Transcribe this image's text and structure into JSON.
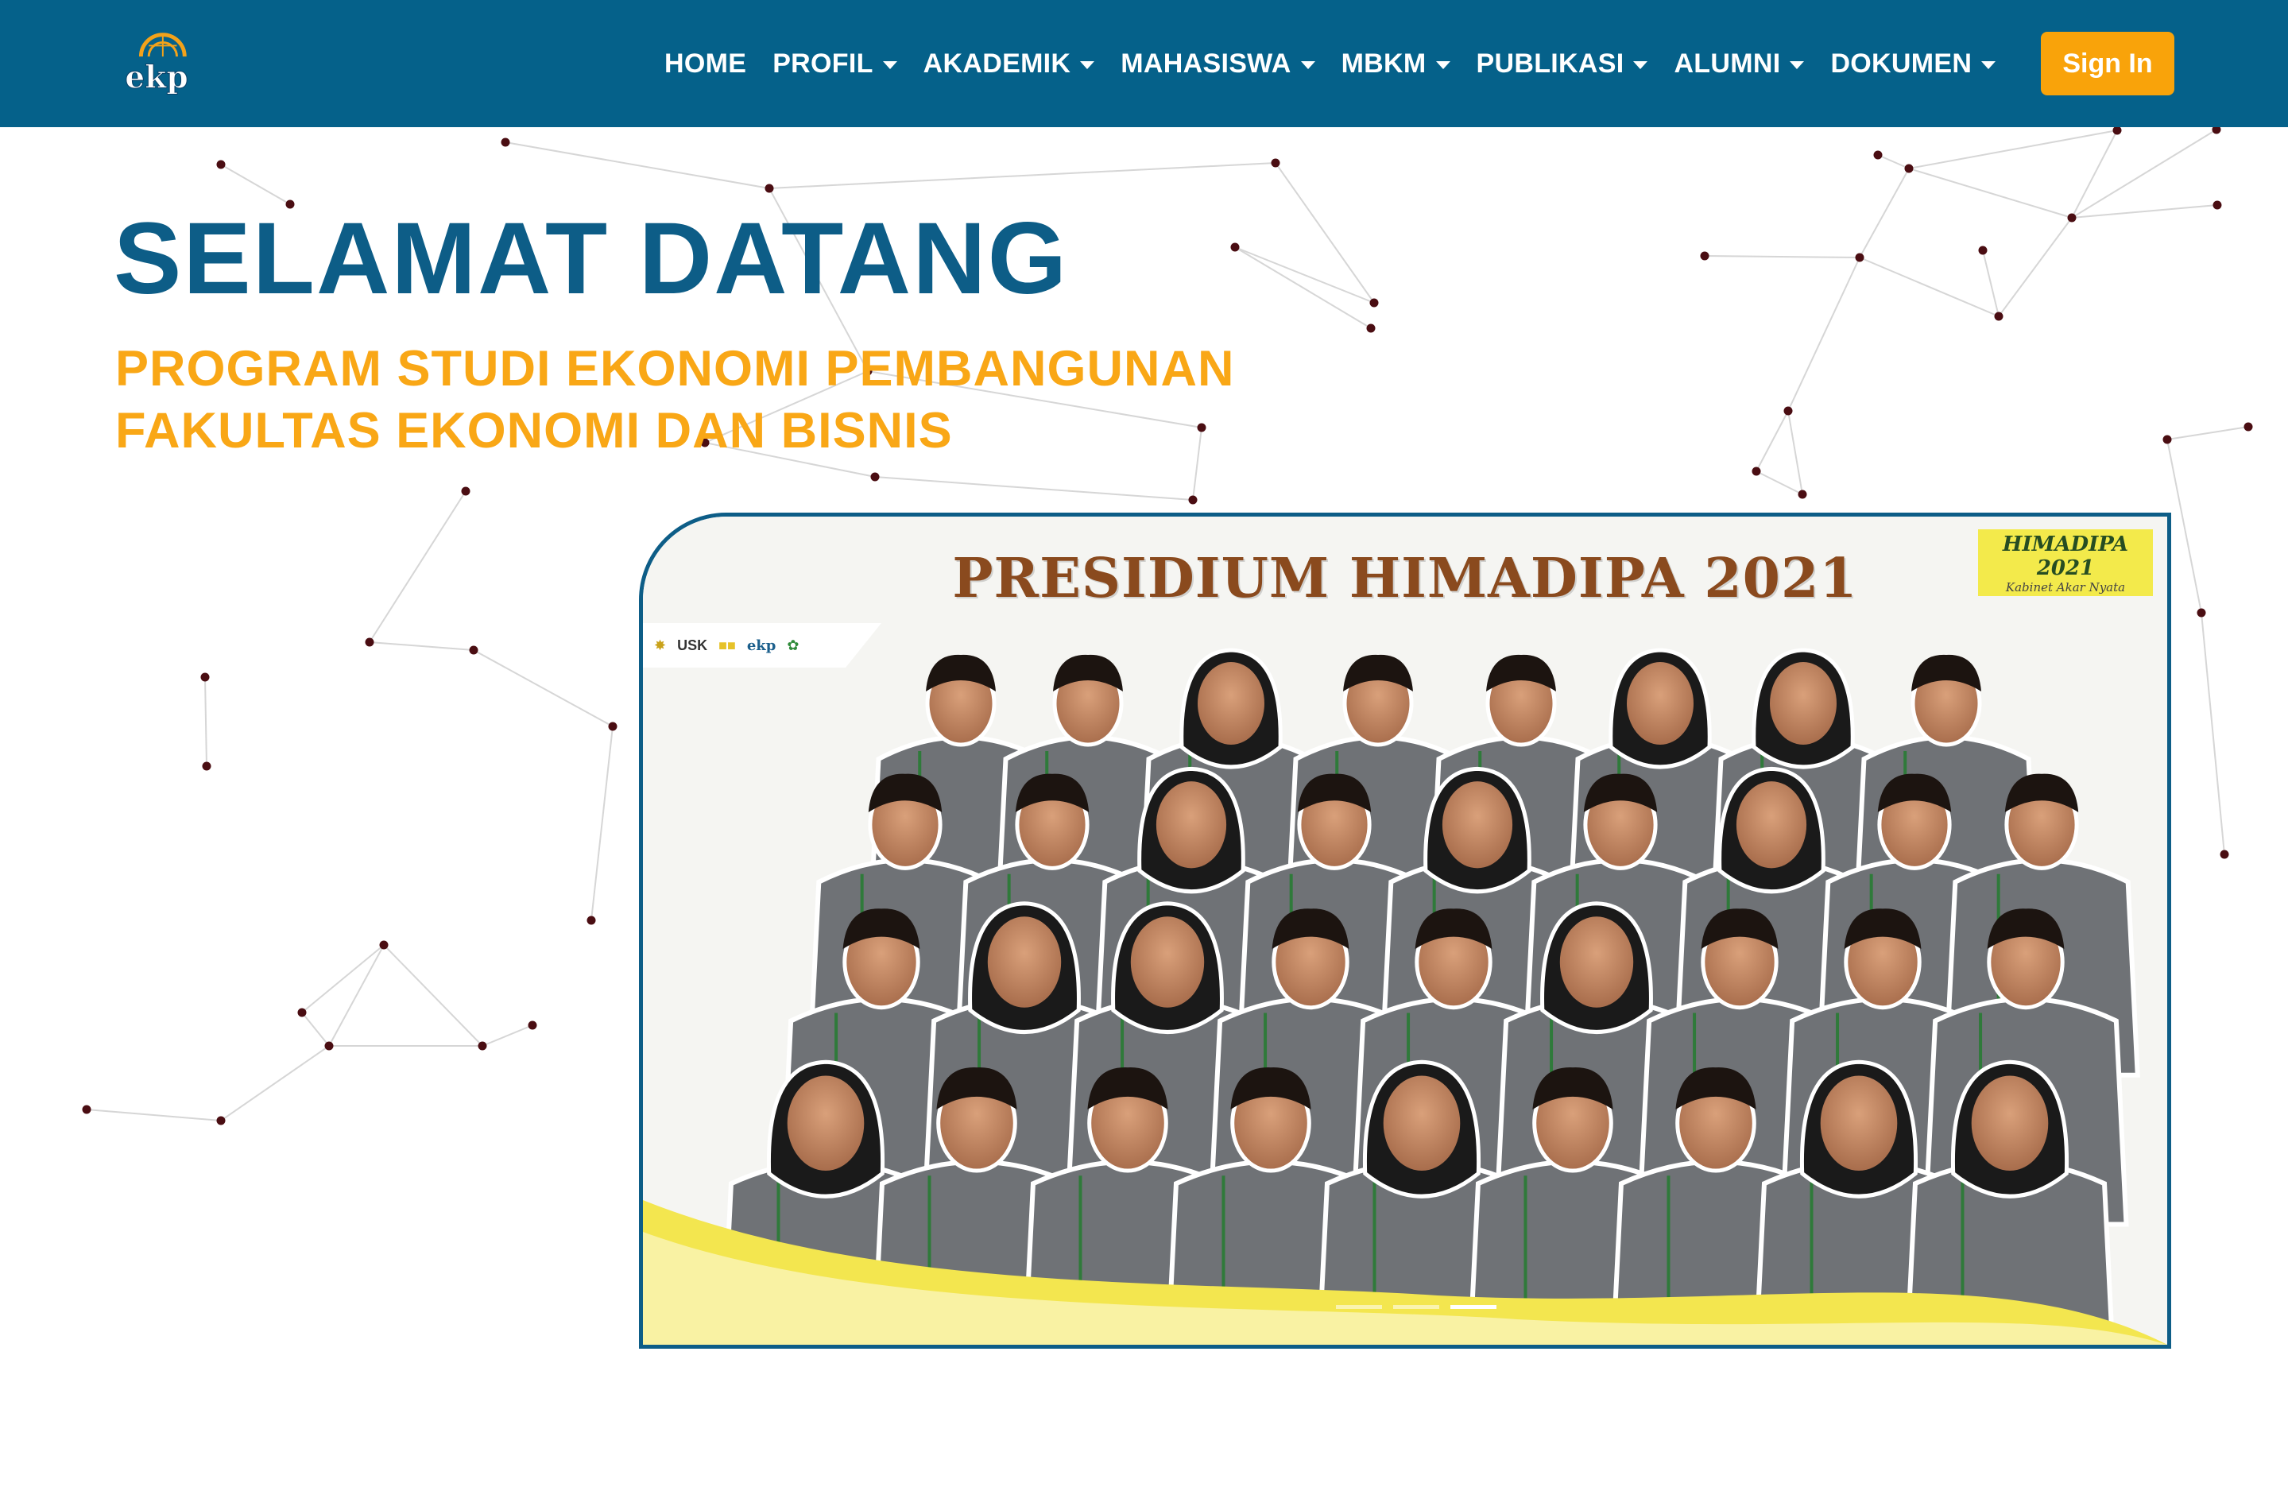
{
  "nav": {
    "items": [
      {
        "label": "HOME",
        "dropdown": false
      },
      {
        "label": "PROFIL",
        "dropdown": true
      },
      {
        "label": "AKADEMIK",
        "dropdown": true
      },
      {
        "label": "MAHASISWA",
        "dropdown": true
      },
      {
        "label": "MBKM",
        "dropdown": true
      },
      {
        "label": "PUBLIKASI",
        "dropdown": true
      },
      {
        "label": "ALUMNI",
        "dropdown": true
      },
      {
        "label": "DOKUMEN",
        "dropdown": true
      }
    ],
    "signin_label": "Sign In",
    "logo_text": "ekp"
  },
  "hero": {
    "title": "SELAMAT DATANG",
    "subtitle_line1": "PROGRAM STUDI EKONOMI PEMBANGUNAN",
    "subtitle_line2": "FAKULTAS EKONOMI DAN BISNIS"
  },
  "carousel": {
    "slide_title": "PRESIDIUM HIMADIPA 2021",
    "badge_title": "HIMADIPA 2021",
    "badge_subtitle": "Kabinet Akar Nyata",
    "partner_logos": [
      "USK",
      "ekp"
    ],
    "slide_count": 3,
    "active_index": 2
  },
  "colors": {
    "navbar_bg": "#05618a",
    "primary_blue": "#0d5d87",
    "accent_orange": "#f9a716",
    "signin_bg": "#f9a30a",
    "network_node": "#4a0d12"
  }
}
